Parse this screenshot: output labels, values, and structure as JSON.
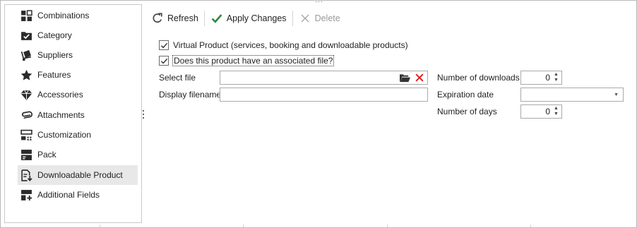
{
  "sidebar": {
    "items": [
      {
        "label": "Combinations",
        "icon": "grid-icon"
      },
      {
        "label": "Category",
        "icon": "checked-folder-icon"
      },
      {
        "label": "Suppliers",
        "icon": "hand-truck-icon"
      },
      {
        "label": "Features",
        "icon": "star-icon"
      },
      {
        "label": "Accessories",
        "icon": "diamond-icon"
      },
      {
        "label": "Attachments",
        "icon": "paperclip-icon"
      },
      {
        "label": "Customization",
        "icon": "customization-icon"
      },
      {
        "label": "Pack",
        "icon": "pack-icon"
      },
      {
        "label": "Downloadable Product",
        "icon": "download-file-icon",
        "selected": true
      },
      {
        "label": "Additional Fields",
        "icon": "add-fields-icon"
      }
    ]
  },
  "toolbar": {
    "refresh_label": "Refresh",
    "apply_label": "Apply Changes",
    "delete_label": "Delete"
  },
  "form": {
    "virtual_product": {
      "label": "Virtual Product (services, booking and downloadable products)",
      "checked": true
    },
    "associated_file": {
      "label": "Does this product have an associated file?",
      "checked": true
    },
    "select_file_label": "Select file",
    "select_file_value": "",
    "display_filename_label": "Display filename",
    "display_filename_value": "",
    "num_downloads_label": "Number of downloads",
    "num_downloads_value": "0",
    "expiration_date_label": "Expiration date",
    "expiration_date_value": "",
    "num_days_label": "Number of days",
    "num_days_value": "0"
  },
  "colors": {
    "accent_green": "#2e8b3a",
    "delete_red": "#e02020",
    "folder_dark": "#333333",
    "icon_dark": "#2b2b2b",
    "selected_bg": "#e8e8e8"
  }
}
